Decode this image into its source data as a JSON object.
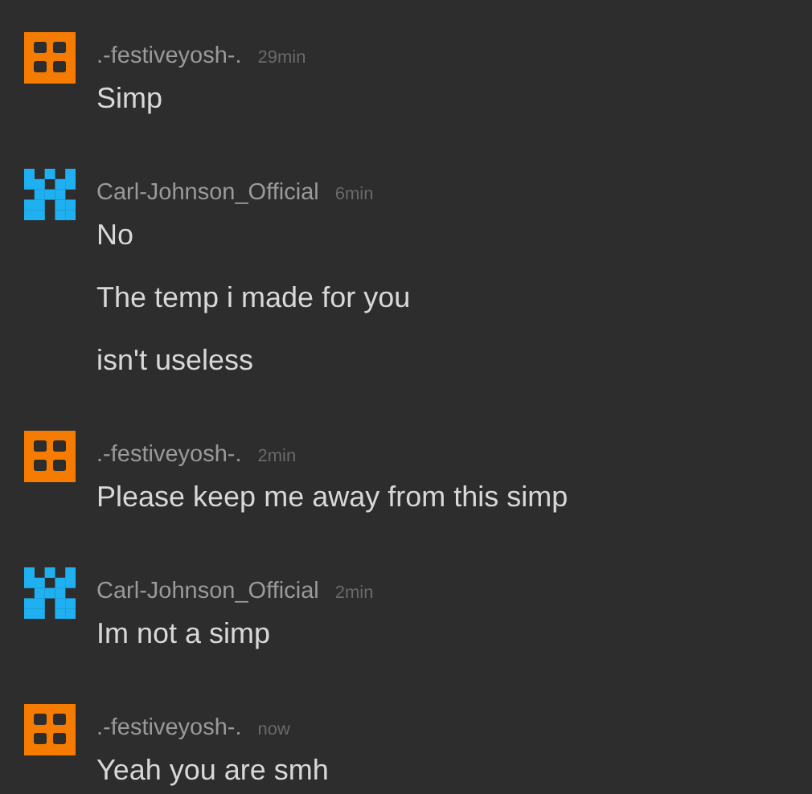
{
  "comments": [
    {
      "user": ".-festiveyosh-.",
      "time": "29min",
      "avatar": {
        "kind": "squares",
        "color": "#f57c00"
      },
      "messages": [
        "Simp"
      ]
    },
    {
      "user": "Carl-Johnson_Official",
      "time": "6min",
      "avatar": {
        "kind": "pixels",
        "color": "#1eb0f0"
      },
      "messages": [
        "No",
        "The temp i made for you",
        "isn't useless"
      ]
    },
    {
      "user": ".-festiveyosh-.",
      "time": "2min",
      "avatar": {
        "kind": "squares",
        "color": "#f57c00"
      },
      "messages": [
        "Please keep me away from this simp"
      ]
    },
    {
      "user": "Carl-Johnson_Official",
      "time": "2min",
      "avatar": {
        "kind": "pixels",
        "color": "#1eb0f0"
      },
      "messages": [
        "Im not a simp"
      ]
    },
    {
      "user": ".-festiveyosh-.",
      "time": "now",
      "avatar": {
        "kind": "squares",
        "color": "#f57c00"
      },
      "messages": [
        "Yeah you are smh"
      ]
    }
  ]
}
